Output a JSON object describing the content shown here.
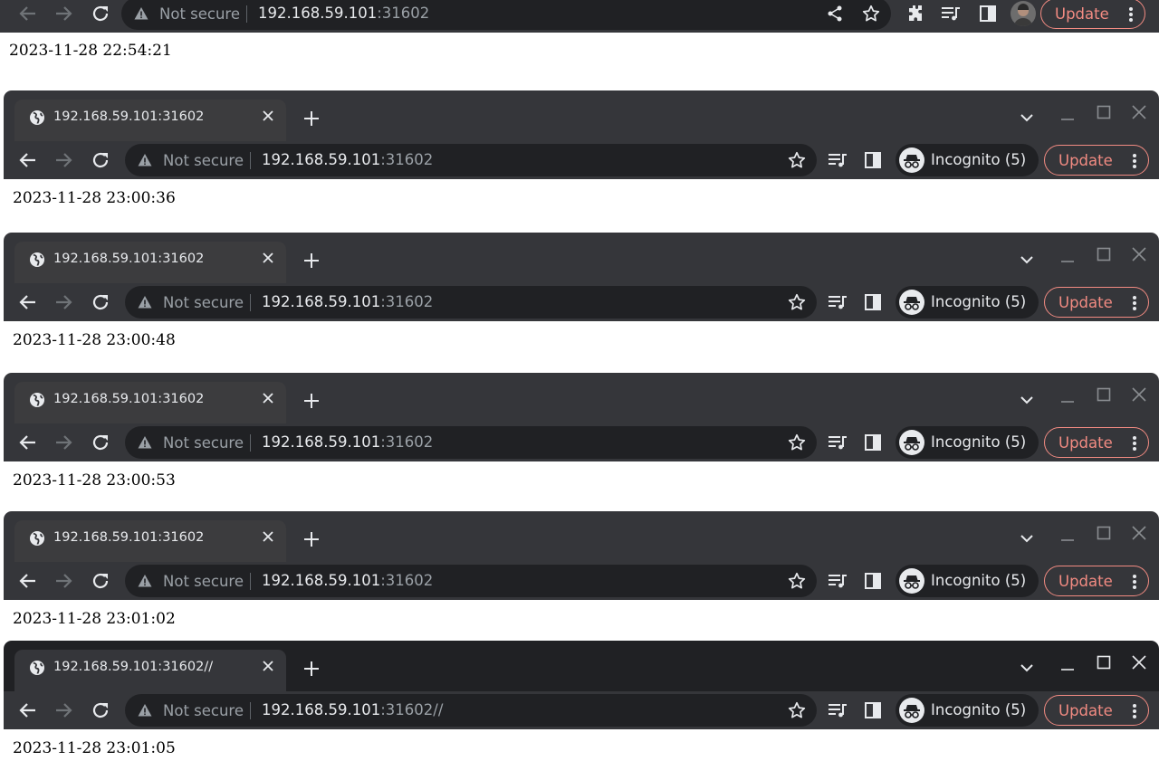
{
  "top": {
    "security_label": "Not secure",
    "url_host": "192.168.59.101",
    "url_rest": ":31602",
    "update_label": "Update",
    "timestamp": "2023-11-28 22:54:21"
  },
  "windows": [
    {
      "tab_title": "192.168.59.101:31602",
      "security_label": "Not secure",
      "url_host": "192.168.59.101",
      "url_rest": ":31602",
      "incognito_label": "Incognito (5)",
      "update_label": "Update",
      "timestamp": "2023-11-28 23:00:36"
    },
    {
      "tab_title": "192.168.59.101:31602",
      "security_label": "Not secure",
      "url_host": "192.168.59.101",
      "url_rest": ":31602",
      "incognito_label": "Incognito (5)",
      "update_label": "Update",
      "timestamp": "2023-11-28 23:00:48"
    },
    {
      "tab_title": "192.168.59.101:31602",
      "security_label": "Not secure",
      "url_host": "192.168.59.101",
      "url_rest": ":31602",
      "incognito_label": "Incognito (5)",
      "update_label": "Update",
      "timestamp": "2023-11-28 23:00:53"
    },
    {
      "tab_title": "192.168.59.101:31602",
      "security_label": "Not secure",
      "url_host": "192.168.59.101",
      "url_rest": ":31602",
      "incognito_label": "Incognito (5)",
      "update_label": "Update",
      "timestamp": "2023-11-28 23:01:02"
    },
    {
      "tab_title": "192.168.59.101:31602//",
      "security_label": "Not secure",
      "url_host": "192.168.59.101",
      "url_rest": ":31602//",
      "incognito_label": "Incognito (5)",
      "update_label": "Update",
      "timestamp": "2023-11-28 23:01:05"
    }
  ],
  "colors": {
    "tabstrip_inactive": "#35363a",
    "tabstrip_active": "#202124",
    "toolbar": "#35363a",
    "omnibox": "#202124",
    "update_accent": "#f28b82",
    "text_primary": "#e8eaed",
    "text_secondary": "#9aa0a6"
  },
  "icons": [
    "back-icon",
    "forward-icon",
    "reload-icon",
    "warning-icon",
    "share-icon",
    "star-icon",
    "extensions-icon",
    "media-icon",
    "side-panel-icon",
    "incognito-icon",
    "kebab-menu-icon",
    "globe-icon",
    "close-icon",
    "plus-icon",
    "chevron-down-icon",
    "minimize-icon",
    "maximize-icon"
  ]
}
